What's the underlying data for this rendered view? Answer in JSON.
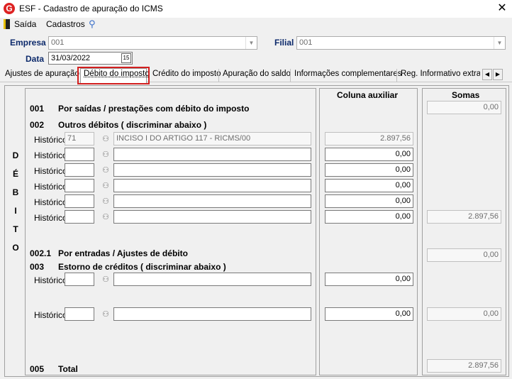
{
  "window": {
    "title": "ESF - Cadastro de apuração do ICMS",
    "icon_letter": "G"
  },
  "menu": {
    "saida": "Saída",
    "cadastros": "Cadastros"
  },
  "header": {
    "empresa_label": "Empresa",
    "empresa_value": "001",
    "filial_label": "Filial",
    "filial_value": "001",
    "data_label": "Data",
    "data_value": "31/03/2022"
  },
  "tabs": [
    "Ajustes de apuração",
    "Débito do imposto",
    "Crédito do imposto",
    "Apuração do saldo",
    "Informações complementares",
    "Reg. Informativo extra apu"
  ],
  "side_label": [
    "D",
    "É",
    "B",
    "I",
    "T",
    "O"
  ],
  "columns": {
    "auxiliar": "Coluna auxiliar",
    "somas": "Somas"
  },
  "rows": {
    "r001_code": "001",
    "r001_text": "Por saídas / prestações com débito do imposto",
    "r001_soma": "0,00",
    "r002_code": "002",
    "r002_text": "Outros débitos ( discriminar abaixo )",
    "r0021_code": "002.1",
    "r0021_text": "Por entradas / Ajustes de débito",
    "r0021_soma": "0,00",
    "r003_code": "003",
    "r003_text": "Estorno de créditos ( discriminar abaixo )",
    "r005_code": "005",
    "r005_text": "Total",
    "r005_soma": "2.897,56"
  },
  "historico_label": "Histórico",
  "outros_debitos": [
    {
      "code": "71",
      "desc": "INCISO I DO ARTIGO 117 - RICMS/00",
      "aux": "2.897,56"
    },
    {
      "code": "",
      "desc": "",
      "aux": "0,00"
    },
    {
      "code": "",
      "desc": "",
      "aux": "0,00"
    },
    {
      "code": "",
      "desc": "",
      "aux": "0,00"
    },
    {
      "code": "",
      "desc": "",
      "aux": "0,00"
    },
    {
      "code": "",
      "desc": "",
      "aux": "0,00"
    }
  ],
  "outros_debitos_soma": "2.897,56",
  "estorno_creditos": [
    {
      "code": "",
      "desc": "",
      "aux": "0,00"
    },
    {
      "code": "",
      "desc": "",
      "aux": "0,00",
      "soma": "0,00"
    }
  ],
  "colors": {
    "label_blue": "#0d2a6b",
    "highlight_red": "#d32020"
  }
}
